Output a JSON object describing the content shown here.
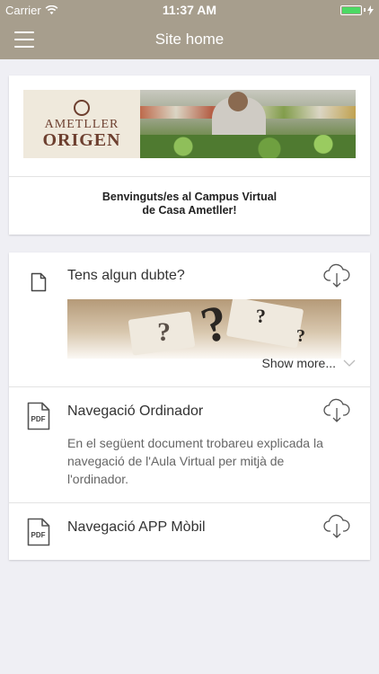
{
  "status": {
    "carrier": "Carrier",
    "time": "11:37 AM"
  },
  "nav": {
    "title": "Site home"
  },
  "banner": {
    "logo_line1": "AMETLLER",
    "logo_line2": "ORIGEN",
    "welcome_line1": "Benvinguts/es al Campus Virtual",
    "welcome_line2": "de Casa Ametller!"
  },
  "items": [
    {
      "title": "Tens algun dubte?",
      "show_more": "Show more..."
    },
    {
      "title": "Navegació Ordinador",
      "pdf": "PDF",
      "description": "En el següent document trobareu explicada la navegació de l'Aula Virtual per mitjà de l'ordinador."
    },
    {
      "title": "Navegació APP Mòbil",
      "pdf": "PDF"
    }
  ],
  "colors": {
    "navbar": "#a79e8d",
    "background": "#efeff4",
    "battery": "#4cd964"
  }
}
